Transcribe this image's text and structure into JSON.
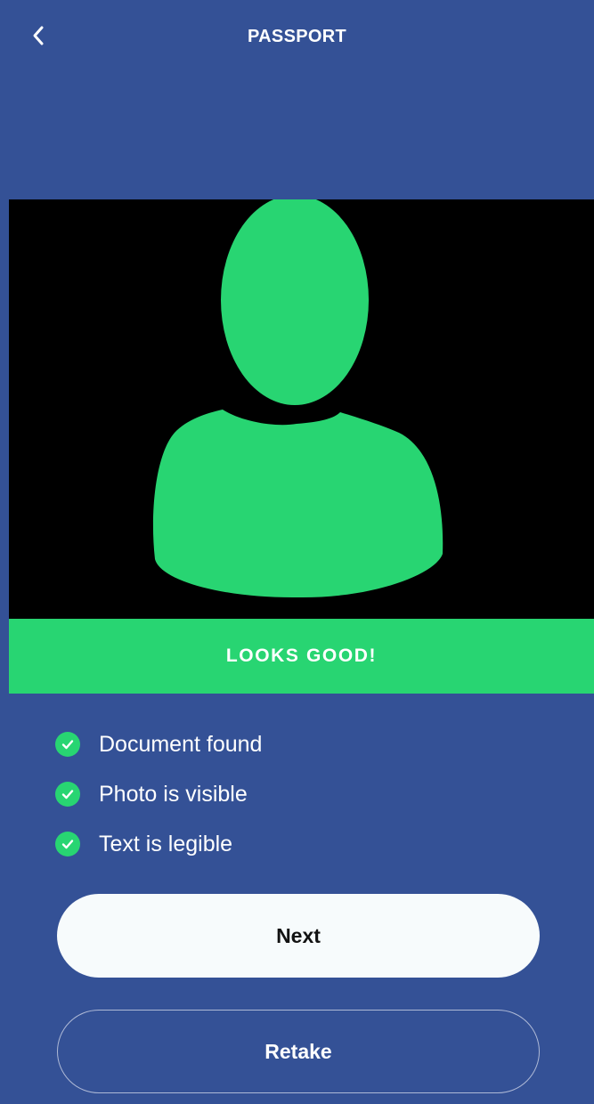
{
  "header": {
    "title": "PASSPORT",
    "back_icon": "chevron-left-icon"
  },
  "preview": {
    "placeholder_icon": "person-silhouette-icon",
    "background": "#000000",
    "silhouette_color": "#28d572"
  },
  "status": {
    "text": "LOOKS GOOD!",
    "color": "#28d572"
  },
  "checks": [
    {
      "label": "Document found",
      "icon": "check-circle-icon"
    },
    {
      "label": "Photo is visible",
      "icon": "check-circle-icon"
    },
    {
      "label": "Text is legible",
      "icon": "check-circle-icon"
    }
  ],
  "buttons": {
    "next_label": "Next",
    "retake_label": "Retake"
  },
  "colors": {
    "brand_blue": "#345196",
    "accent_green": "#28d572"
  }
}
